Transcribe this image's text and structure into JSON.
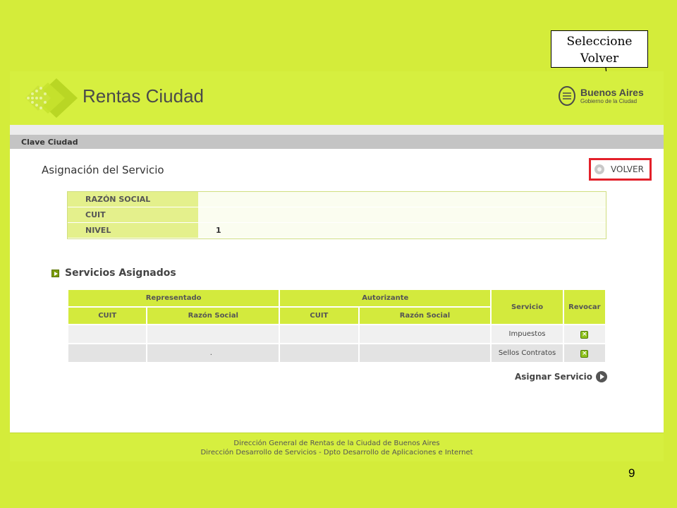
{
  "callout": {
    "line1": "Seleccione",
    "line2": "Volver"
  },
  "header": {
    "app_name": "Rentas Ciudad",
    "gov_title": "Buenos Aires",
    "gov_subtitle": "Gobierno de la Ciudad",
    "logo_icon": "rentas-ciudad-diamond-icon",
    "emblem_icon": "buenos-aires-emblem-icon"
  },
  "breadcrumb": "Clave Ciudad",
  "page_title": "Asignación del Servicio",
  "volver": {
    "label": "VOLVER",
    "icon": "circle-back-icon",
    "highlight_color": "#e3202a"
  },
  "info": {
    "rows": [
      {
        "label": "RAZÓN SOCIAL",
        "value": ""
      },
      {
        "label": "CUIT",
        "value": ""
      },
      {
        "label": "NIVEL",
        "value": "1"
      }
    ]
  },
  "services": {
    "title": "Servicios Asignados",
    "headers": {
      "representado": "Representado",
      "autorizante": "Autorizante",
      "servicio": "Servicio",
      "revocar": "Revocar",
      "cuit": "CUIT",
      "razon_social": "Razón Social"
    },
    "rows": [
      {
        "rep_cuit": "",
        "rep_razon": "",
        "aut_cuit": "",
        "aut_razon": "",
        "servicio": "Impuestos",
        "revocar_icon": "revoke-x-icon"
      },
      {
        "rep_cuit": "",
        "rep_razon": ".",
        "aut_cuit": "",
        "aut_razon": "",
        "servicio": "Sellos Contratos",
        "revocar_icon": "revoke-x-icon"
      }
    ],
    "assign_label": "Asignar Servicio",
    "assign_icon": "play-circle-icon"
  },
  "footer": {
    "line1": "Dirección General de Rentas de la Ciudad de Buenos Aires",
    "line2": "Dirección Desarrollo de Servicios - Dpto Desarrollo de Aplicaciones e Internet"
  },
  "slide_number": "9",
  "colors": {
    "background": "#d4ec3a",
    "header": "#d6ef3f",
    "cell_label": "#e4f08c"
  }
}
